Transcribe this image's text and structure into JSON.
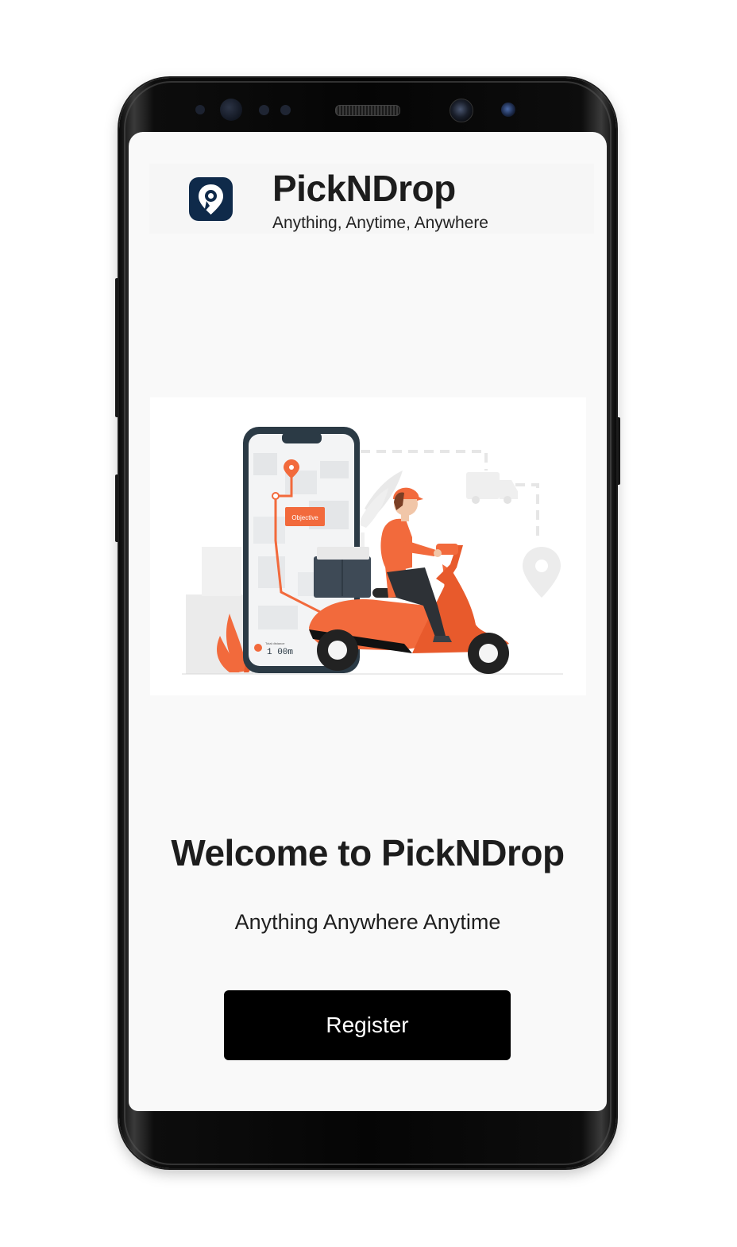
{
  "app": {
    "title": "PickNDrop",
    "tagline": "Anything, Anytime, Anywhere"
  },
  "hero": {
    "illustration": "delivery-scooter-with-phone-map",
    "map_label": "Objective",
    "distance_caption": "Total distance",
    "distance_value": "1 00m"
  },
  "welcome": {
    "heading": "Welcome to PickNDrop",
    "subtitle": "Anything Anywhere Anytime"
  },
  "actions": {
    "register_label": "Register"
  },
  "colors": {
    "brand_navy": "#0f2a4a",
    "accent_orange": "#f26a3c",
    "button_bg": "#000000",
    "screen_bg": "#f9f9f9"
  }
}
